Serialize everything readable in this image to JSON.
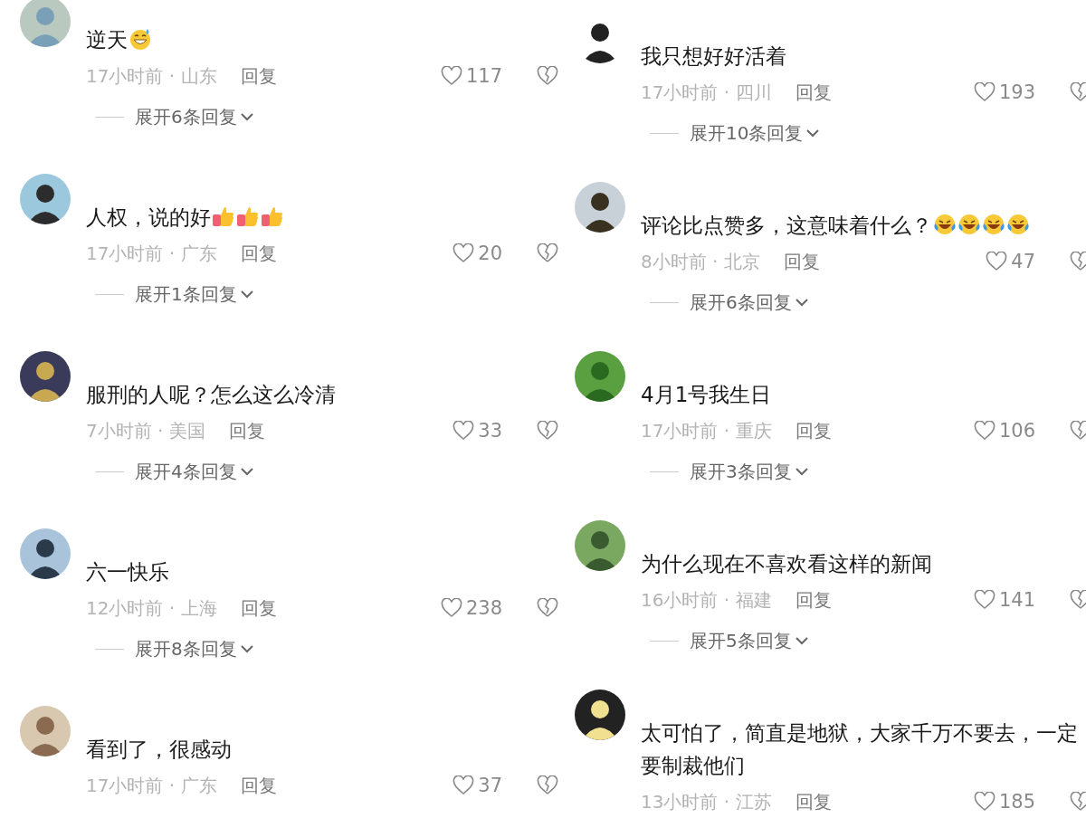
{
  "columns": [
    {
      "comments": [
        {
          "text": "逆天",
          "emojis": [
            {
              "kind": "grin-sweat"
            }
          ],
          "time": "17小时前 · 山东",
          "reply": "回复",
          "likes": "117",
          "expand": "展开6条回复"
        },
        {
          "text": "人权，说的好",
          "emojis": [
            {
              "kind": "thumbs-up"
            },
            {
              "kind": "thumbs-up"
            },
            {
              "kind": "thumbs-up"
            }
          ],
          "time": "17小时前 · 广东",
          "reply": "回复",
          "likes": "20",
          "expand": "展开1条回复"
        },
        {
          "text": "服刑的人呢？怎么这么冷清",
          "time": "7小时前 · 美国",
          "reply": "回复",
          "likes": "33",
          "expand": "展开4条回复"
        },
        {
          "text": "六一快乐",
          "time": "12小时前 · 上海",
          "reply": "回复",
          "likes": "238",
          "expand": "展开8条回复"
        },
        {
          "text": "看到了，很感动",
          "time": "17小时前 · 广东",
          "reply": "回复",
          "likes": "37"
        }
      ]
    },
    {
      "comments": [
        {
          "text": "我只想好好活着",
          "time": "17小时前 · 四川",
          "reply": "回复",
          "likes": "193",
          "expand": "展开10条回复"
        },
        {
          "text": "评论比点赞多，这意味着什么？",
          "emojis": [
            {
              "kind": "laugh-cry"
            },
            {
              "kind": "laugh-cry"
            },
            {
              "kind": "laugh-cry"
            },
            {
              "kind": "laugh-cry"
            }
          ],
          "time": "8小时前 · 北京",
          "reply": "回复",
          "likes": "47",
          "expand": "展开6条回复"
        },
        {
          "text": "4月1号我生日",
          "time": "17小时前 · 重庆",
          "reply": "回复",
          "likes": "106",
          "expand": "展开3条回复"
        },
        {
          "text": "为什么现在不喜欢看这样的新闻",
          "time": "16小时前 · 福建",
          "reply": "回复",
          "likes": "141",
          "expand": "展开5条回复"
        },
        {
          "text": "太可怕了，简直是地狱，大家千万不要去，一定要制裁他们",
          "time": "13小时前 · 江苏",
          "reply": "回复",
          "likes": "185"
        }
      ]
    }
  ]
}
